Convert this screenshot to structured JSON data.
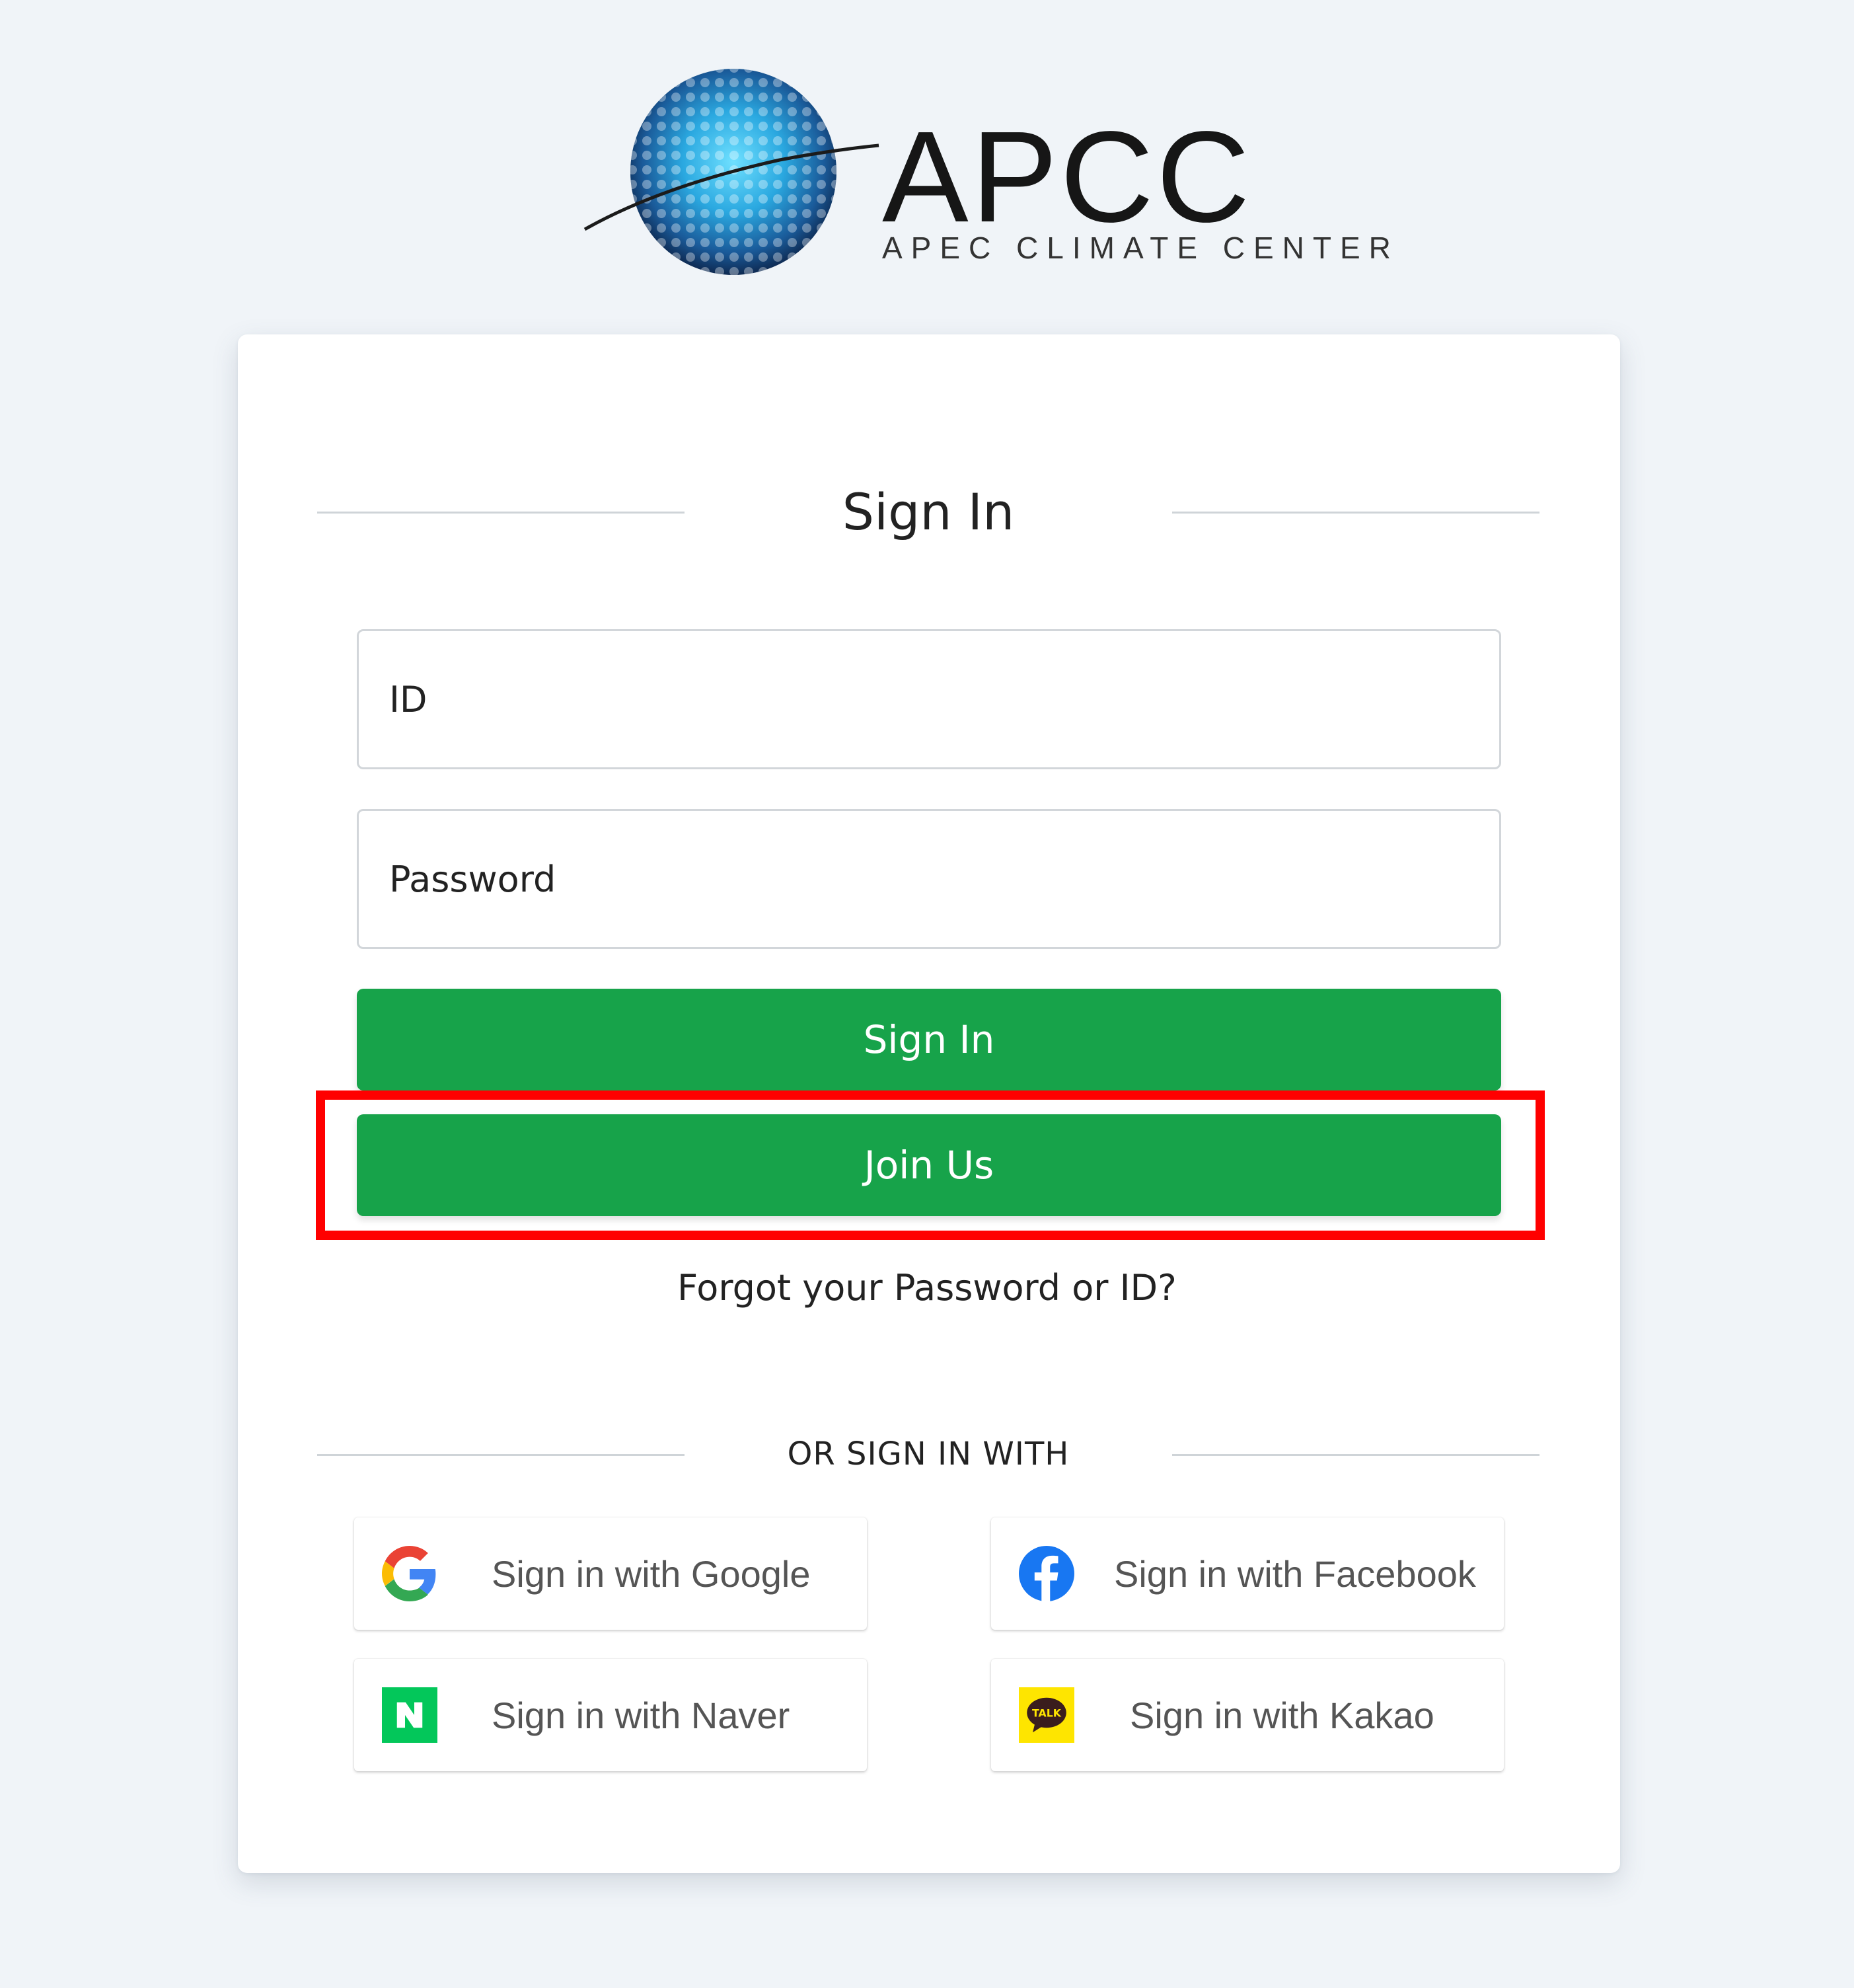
{
  "logo": {
    "wordmark": "APCC",
    "subtitle": "APEC CLIMATE CENTER"
  },
  "signin": {
    "title": "Sign In",
    "id_placeholder": "ID",
    "password_placeholder": "Password",
    "signin_button": "Sign In",
    "join_button": "Join Us",
    "forgot_link": "Forgot your Password or ID?"
  },
  "social": {
    "heading": "OR SIGN IN WITH",
    "google": "Sign in with Google",
    "facebook": "Sign in with Facebook",
    "naver": "Sign in with Naver",
    "kakao": "Sign in with Kakao",
    "kakao_badge": "TALK",
    "naver_badge": "N"
  },
  "colors": {
    "primary_green": "#17a34a",
    "highlight_red": "#ff0000",
    "background": "#f0f4f8"
  },
  "icons": [
    "globe-logo",
    "google-icon",
    "facebook-icon",
    "naver-icon",
    "kakao-icon"
  ]
}
